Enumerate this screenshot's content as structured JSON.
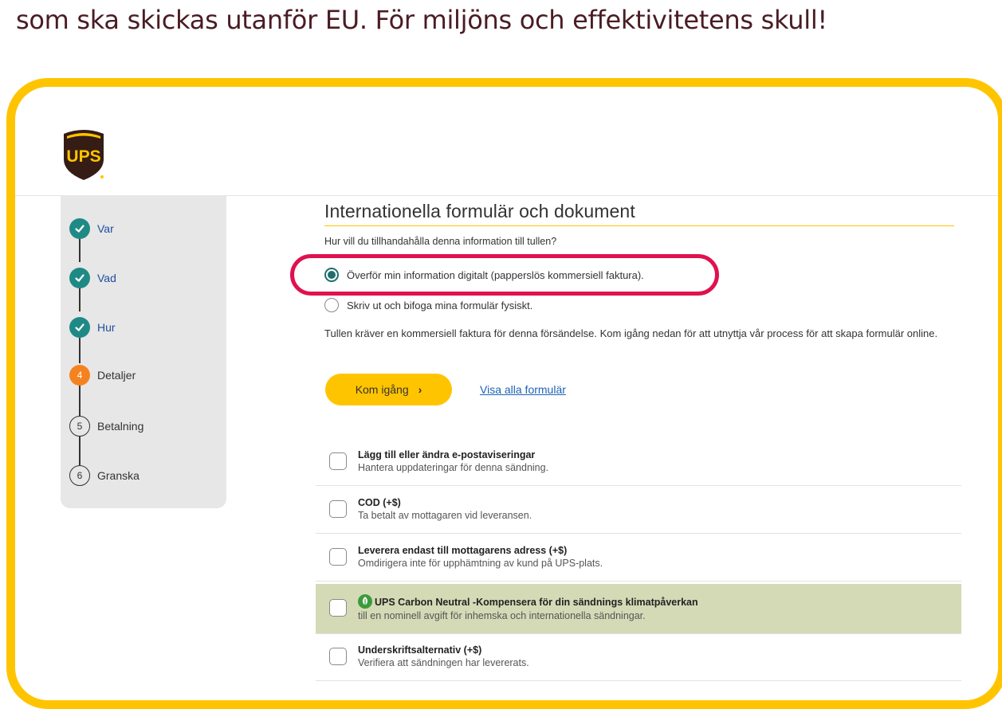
{
  "caption": "som ska skickas utanför EU. För miljöns och effektivitetens skull!",
  "logo_text": "UPS",
  "colors": {
    "accent": "#ffc400",
    "highlight": "#e0114f",
    "done": "#1f8a85",
    "current": "#f4831f",
    "link": "#1d63b5",
    "brand": "#351c15"
  },
  "steps": [
    {
      "number": "",
      "label": "Var",
      "state": "done"
    },
    {
      "number": "",
      "label": "Vad",
      "state": "done"
    },
    {
      "number": "",
      "label": "Hur",
      "state": "done"
    },
    {
      "number": "4",
      "label": "Detaljer",
      "state": "current"
    },
    {
      "number": "5",
      "label": "Betalning",
      "state": "todo"
    },
    {
      "number": "6",
      "label": "Granska",
      "state": "todo"
    }
  ],
  "main": {
    "title": "Internationella formulär och dokument",
    "question": "Hur vill du tillhandahålla denna information till tullen?",
    "options": [
      {
        "label": "Överför min information digitalt (papperslös kommersiell faktura).",
        "selected": true
      },
      {
        "label": "Skriv ut och bifoga mina formulär fysiskt.",
        "selected": false
      }
    ],
    "info": "Tullen kräver en kommersiell faktura för denna försändelse. Kom igång nedan för att utnyttja vår process för att skapa formulär online.",
    "start_button": "Kom igång",
    "start_chevron": "›",
    "view_all_link": "Visa alla formulär"
  },
  "extras": [
    {
      "title": "Lägg till eller ändra e-postaviseringar",
      "desc": "Hantera uppdateringar för denna sändning.",
      "checked": false
    },
    {
      "title": "COD (+$)",
      "desc": "Ta betalt av mottagaren vid leveransen.",
      "checked": false
    },
    {
      "title": "Leverera endast till mottagarens adress (+$)",
      "desc": "Omdirigera inte för upphämtning av kund på UPS-plats.",
      "checked": false
    },
    {
      "title": "UPS Carbon Neutral -Kompensera för din sändnings klimatpåverkan",
      "desc": "till en nominell avgift för inhemska och internationella sändningar.",
      "checked": false,
      "icon": "leaf-icon"
    },
    {
      "title": "Underskriftsalternativ (+$)",
      "desc": "Verifiera att sändningen har levererats.",
      "checked": false
    }
  ]
}
